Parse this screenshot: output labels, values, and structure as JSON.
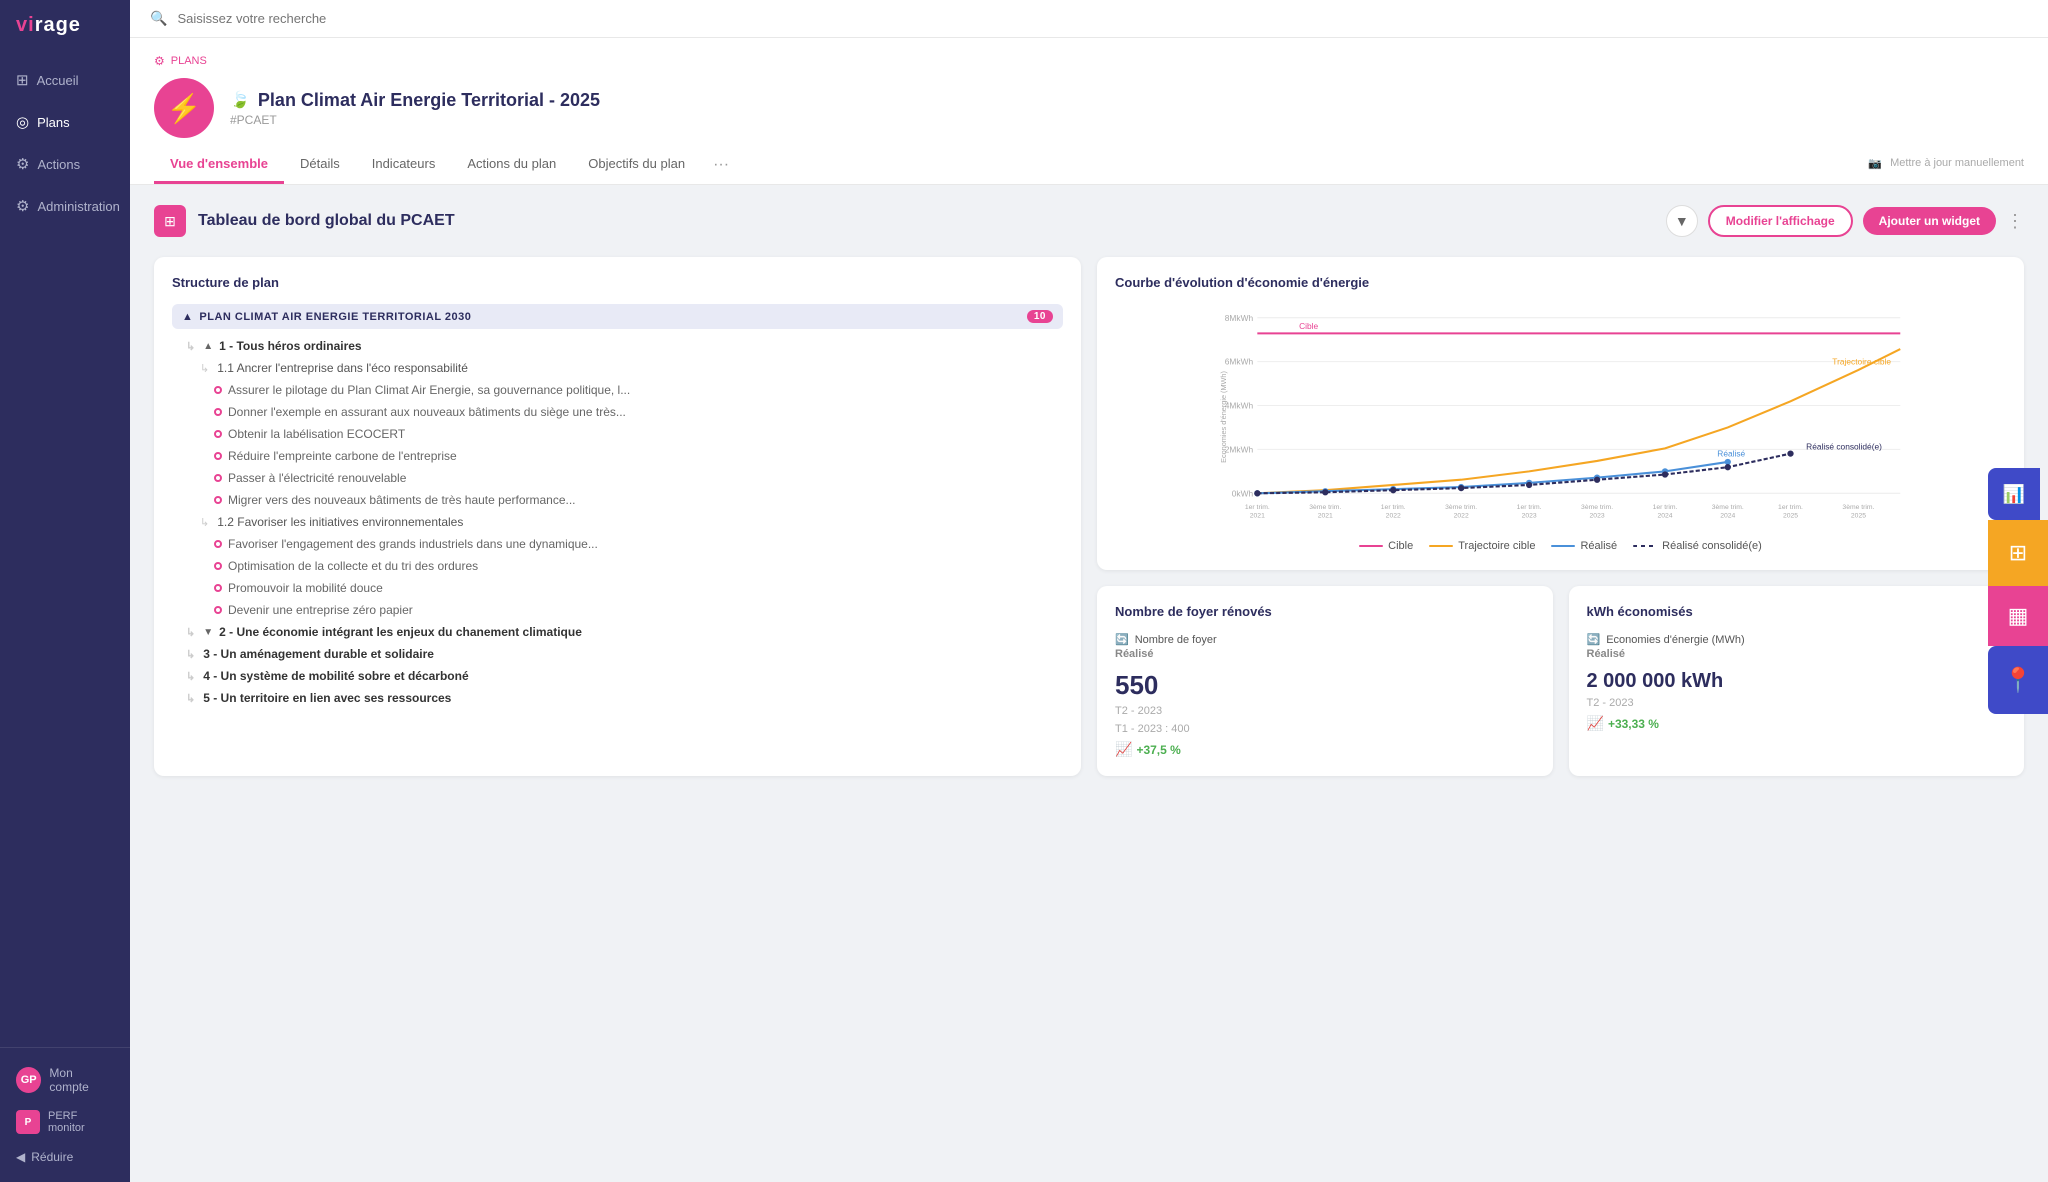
{
  "app": {
    "name": "virage",
    "logo_accent": "vi",
    "logo_rest": "rage"
  },
  "sidebar": {
    "items": [
      {
        "id": "accueil",
        "label": "Accueil",
        "icon": "⊞",
        "active": false
      },
      {
        "id": "plans",
        "label": "Plans",
        "icon": "◎",
        "active": true
      },
      {
        "id": "actions",
        "label": "Actions",
        "icon": "⚙",
        "active": false
      },
      {
        "id": "administration",
        "label": "Administration",
        "icon": "⚙",
        "active": false
      }
    ],
    "user": {
      "initials": "GP",
      "label": "Mon compte"
    },
    "perf_label": "PERF\nmonitor",
    "reduce_label": "Réduire"
  },
  "search": {
    "placeholder": "Saisissez votre recherche"
  },
  "plan": {
    "breadcrumb": "PLANS",
    "title": "Plan Climat Air Energie Territorial - 2025",
    "hashtag": "#PCAET",
    "tabs": [
      {
        "id": "vue-ensemble",
        "label": "Vue d'ensemble",
        "active": true
      },
      {
        "id": "details",
        "label": "Détails",
        "active": false
      },
      {
        "id": "indicateurs",
        "label": "Indicateurs",
        "active": false
      },
      {
        "id": "actions-plan",
        "label": "Actions du plan",
        "active": false
      },
      {
        "id": "objectifs",
        "label": "Objectifs du plan",
        "active": false
      }
    ],
    "tab_more": "···",
    "tab_right_text": "Mettre à jour manuellement"
  },
  "dashboard": {
    "title": "Tableau de bord global du PCAET",
    "btn_modifier": "Modifier l'affichage",
    "btn_ajouter": "Ajouter un widget"
  },
  "structure": {
    "title": "Structure de plan",
    "group_label": "PLAN CLIMAT AIR ENERGIE TERRITORIAL 2030",
    "group_count": "10",
    "items": [
      {
        "level": 1,
        "label": "1 - Tous héros ordinaires",
        "type": "parent"
      },
      {
        "level": 2,
        "label": "1.1 Ancrer l'entreprise dans l'éco responsabilité",
        "type": "sub"
      },
      {
        "level": 3,
        "label": "Assurer le pilotage du Plan Climat Air Energie, sa gouvernance politique, l..."
      },
      {
        "level": 3,
        "label": "Donner l'exemple en assurant aux nouveaux bâtiments du siège une très..."
      },
      {
        "level": 3,
        "label": "Obtenir la labélisation ECOCERT"
      },
      {
        "level": 3,
        "label": "Réduire l'empreinte carbone de l'entreprise"
      },
      {
        "level": 3,
        "label": "Passer à l'électricité renouvelable"
      },
      {
        "level": 3,
        "label": "Migrer vers des nouveaux bâtiments de très haute performance..."
      },
      {
        "level": 2,
        "label": "1.2 Favoriser les initiatives environnementales",
        "type": "sub"
      },
      {
        "level": 3,
        "label": "Favoriser l'engagement des grands industriels dans une dynamique..."
      },
      {
        "level": 3,
        "label": "Optimisation de la collecte et du tri des ordures"
      },
      {
        "level": 3,
        "label": "Promouvoir la mobilité douce"
      },
      {
        "level": 3,
        "label": "Devenir une entreprise zéro papier"
      },
      {
        "level": 1,
        "label": "2 - Une économie intégrant les enjeux du chanement climatique",
        "type": "parent",
        "collapsed": true
      },
      {
        "level": 1,
        "label": "3 - Un aménagement durable et solidaire",
        "type": "parent-collapsed"
      },
      {
        "level": 1,
        "label": "4 - Un système de mobilité sobre et décarboné",
        "type": "parent-collapsed"
      },
      {
        "level": 1,
        "label": "5 - Un territoire en lien avec ses ressources",
        "type": "parent-collapsed"
      }
    ]
  },
  "chart": {
    "title": "Courbe d'évolution d'économie d'énergie",
    "y_axis_label": "Economies d'énergie (MWh)",
    "y_ticks": [
      "0kWh",
      "2MkWh",
      "4MkWh",
      "6MkWh",
      "8MkWh"
    ],
    "x_ticks": [
      "1er trim. 2021",
      "3ème trim. 2021",
      "1er trim. 2022",
      "3ème trim. 2022",
      "1er trim. 2023",
      "3ème trim. 2023",
      "1er trim. 2024",
      "3ème trim. 2024",
      "1er trim. 2025",
      "3ème trim. 2025"
    ],
    "labels": {
      "cible": "Cible",
      "trajectoire_cible": "Trajectoire cible",
      "realise": "Réalisé",
      "realise_consolide": "Réalisé consolidé(e)"
    },
    "colors": {
      "cible": "#e84393",
      "trajectoire_cible": "#f5a623",
      "realise": "#4a90d9",
      "realise_consolide": "#2d2d5e"
    },
    "legend": [
      {
        "key": "cible",
        "label": "Cible",
        "color": "#e84393"
      },
      {
        "key": "trajectoire_cible",
        "label": "Trajectoire cible",
        "color": "#f5a623"
      },
      {
        "key": "realise",
        "label": "Réalisé",
        "color": "#4a90d9"
      },
      {
        "key": "realise_consolide",
        "label": "Réalisé consolidé(e)",
        "color": "#2d2d5e"
      }
    ]
  },
  "kpi": {
    "foyer": {
      "title": "Nombre de foyer rénovés",
      "label": "Nombre de foyer",
      "sublabel": "Réalisé",
      "value": "550",
      "period": "T2 - 2023",
      "sub_period": "T1 - 2023 : 400",
      "change": "+37,5 %",
      "icon": "🔄"
    },
    "kwh": {
      "title": "kWh économisés",
      "label": "Economies d'énergie (MWh)",
      "sublabel": "Réalisé",
      "value": "2 000 000 kWh",
      "period": "T2 - 2023",
      "change": "+33,33 %",
      "icon": "🔄"
    }
  },
  "floating": {
    "analytics_icon": "📈",
    "dashboard_icon": "⊞",
    "widgets_icon": "▦",
    "location_icon": "📍"
  }
}
